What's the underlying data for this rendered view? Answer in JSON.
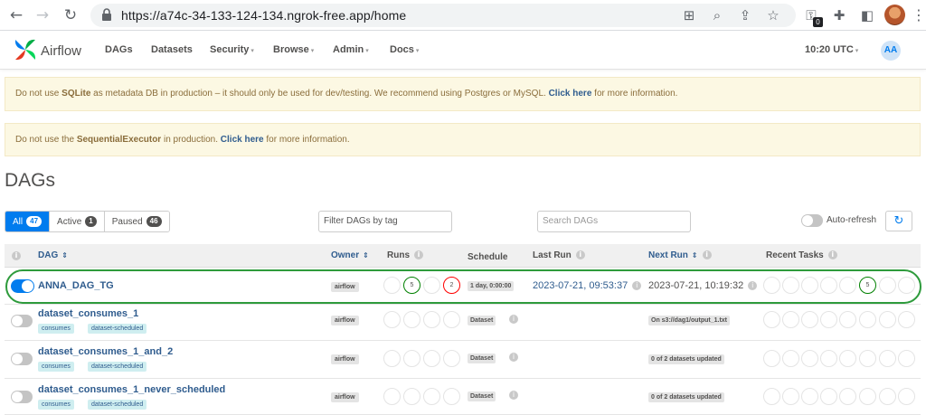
{
  "browser": {
    "url": "https://a74c-34-133-124-134.ngrok-free.app/home",
    "extension_badge": "0"
  },
  "navbar": {
    "brand": "Airflow",
    "menu": [
      {
        "label": "DAGs",
        "dropdown": false
      },
      {
        "label": "Datasets",
        "dropdown": false
      },
      {
        "label": "Security",
        "dropdown": true
      },
      {
        "label": "Browse",
        "dropdown": true
      },
      {
        "label": "Admin",
        "dropdown": true
      },
      {
        "label": "Docs",
        "dropdown": true
      }
    ],
    "clock": "10:20 UTC",
    "avatar_initials": "AA"
  },
  "alerts": [
    {
      "parts": [
        "Do not use ",
        "SQLite",
        " as metadata DB in production – it should only be used for dev/testing. We recommend using Postgres or MySQL. ",
        "Click here",
        " for more information."
      ]
    },
    {
      "parts": [
        "Do not use the ",
        "SequentialExecutor",
        " in production. ",
        "Click here",
        " for more information."
      ]
    }
  ],
  "page_title": "DAGs",
  "filters": {
    "all": {
      "label": "All",
      "count": "47"
    },
    "active": {
      "label": "Active",
      "count": "1"
    },
    "paused": {
      "label": "Paused",
      "count": "46"
    },
    "tag_filter_placeholder": "Filter DAGs by tag",
    "search_placeholder": "Search DAGs",
    "autorefresh_label": "Auto-refresh"
  },
  "table": {
    "headers": {
      "dag": "DAG",
      "owner": "Owner",
      "runs": "Runs",
      "schedule": "Schedule",
      "last_run": "Last Run",
      "next_run": "Next Run",
      "recent_tasks": "Recent Tasks"
    },
    "rows": [
      {
        "name": "ANNA_DAG_TG",
        "active": true,
        "tags": [],
        "owner": "airflow",
        "runs": [
          "",
          "5",
          "",
          "2"
        ],
        "schedule": "1 day, 0:00:00",
        "last_run": "2023-07-21, 09:53:37",
        "next_run": "2023-07-21, 10:19:32",
        "recent_tasks_success": "5"
      },
      {
        "name": "dataset_consumes_1",
        "active": false,
        "tags": [
          "consumes",
          "dataset-scheduled"
        ],
        "owner": "airflow",
        "schedule": "Dataset",
        "last_run": "",
        "next_run": "On s3://dag1/output_1.txt"
      },
      {
        "name": "dataset_consumes_1_and_2",
        "active": false,
        "tags": [
          "consumes",
          "dataset-scheduled"
        ],
        "owner": "airflow",
        "schedule": "Dataset",
        "last_run": "",
        "next_run": "0 of 2 datasets updated"
      },
      {
        "name": "dataset_consumes_1_never_scheduled",
        "active": false,
        "tags": [
          "consumes",
          "dataset-scheduled"
        ],
        "owner": "airflow",
        "schedule": "Dataset",
        "last_run": "",
        "next_run": "0 of 2 datasets updated"
      }
    ]
  }
}
